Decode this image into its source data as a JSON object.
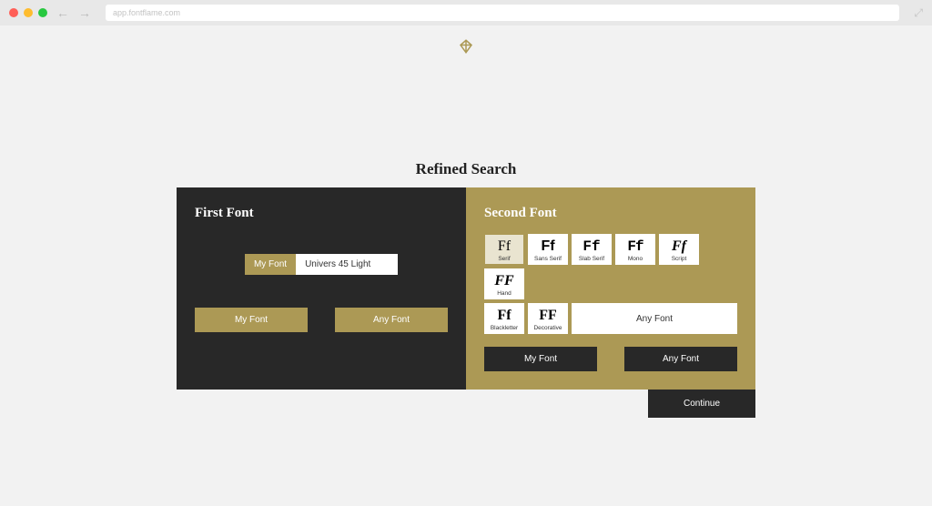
{
  "browser": {
    "url": "app.fontflame.com"
  },
  "title": "Refined Search",
  "left_panel": {
    "heading": "First Font",
    "badge_label": "My Font",
    "input_value": "Univers 45 Light",
    "btn_myfont": "My Font",
    "btn_anyfont": "Any Font"
  },
  "right_panel": {
    "heading": "Second Font",
    "categories": [
      {
        "label": "Serif",
        "glyph": "Ff",
        "class": "g-serif",
        "selected": true
      },
      {
        "label": "Sans Serif",
        "glyph": "Ff",
        "class": "g-sans",
        "selected": false
      },
      {
        "label": "Slab Serif",
        "glyph": "Ff",
        "class": "g-slab",
        "selected": false
      },
      {
        "label": "Mono",
        "glyph": "Ff",
        "class": "g-mono",
        "selected": false
      },
      {
        "label": "Script",
        "glyph": "Ff",
        "class": "g-script",
        "selected": false
      },
      {
        "label": "Hand",
        "glyph": "FF",
        "class": "g-hand",
        "selected": false
      },
      {
        "label": "Blackletter",
        "glyph": "Ff",
        "class": "g-black",
        "selected": false
      },
      {
        "label": "Decorative",
        "glyph": "FF",
        "class": "g-deco",
        "selected": false
      }
    ],
    "anyfont_tile": "Any Font",
    "btn_myfont": "My Font",
    "btn_anyfont": "Any Font"
  },
  "continue_label": "Continue"
}
